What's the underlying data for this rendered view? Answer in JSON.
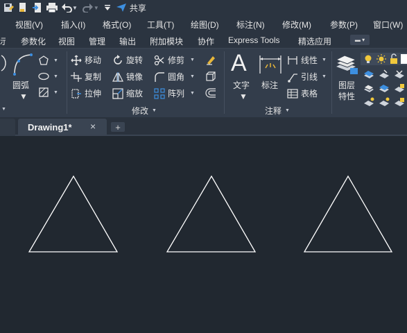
{
  "quick_access": {
    "share_label": "共享"
  },
  "menu": {
    "items": [
      "视图(V)",
      "插入(I)",
      "格式(O)",
      "工具(T)",
      "绘图(D)",
      "标注(N)",
      "修改(M)",
      "参数(P)",
      "窗口(W)"
    ]
  },
  "ribbon_tabs": {
    "items": [
      "参数化",
      "视图",
      "管理",
      "输出",
      "附加模块",
      "协作",
      "Express Tools",
      "精选应用"
    ]
  },
  "draw_panel": {
    "arc_label": "圆弧"
  },
  "modify_panel": {
    "title": "修改",
    "move": "移动",
    "rotate": "旋转",
    "trim": "修剪",
    "copy": "复制",
    "mirror": "镜像",
    "fillet": "圆角",
    "stretch": "拉伸",
    "scale": "缩放",
    "array": "阵列"
  },
  "annotation_panel": {
    "title": "注释",
    "text": "文字",
    "dimension": "标注",
    "linear": "线性",
    "leader": "引线",
    "table": "表格"
  },
  "layers_panel": {
    "layer_properties_line1": "图层",
    "layer_properties_line2": "特性"
  },
  "document": {
    "tab_name": "Drawing1*",
    "close_symbol": "×",
    "add_symbol": "+"
  },
  "drawing": {
    "shapes": [
      "triangle",
      "triangle",
      "triangle"
    ],
    "line_color": "#ffffff",
    "background_color": "#212830"
  },
  "colors": {
    "toolbar_bg": "#2b3440",
    "ribbon_bg": "#333d4b",
    "accent_blue": "#3d8fe0"
  }
}
